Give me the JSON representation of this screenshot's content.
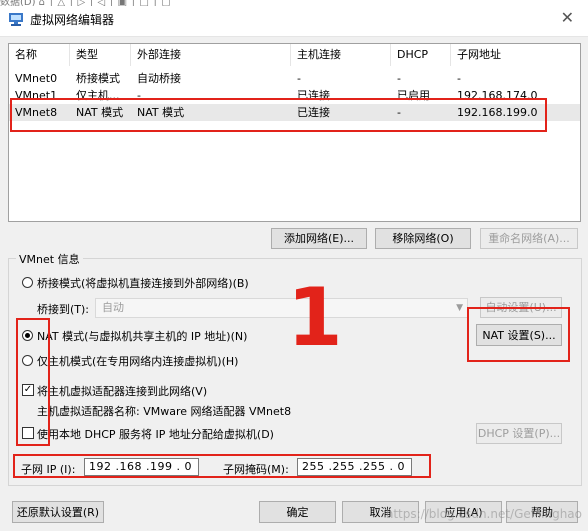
{
  "window": {
    "title": "虚拟网络编辑器",
    "top_text": "  数据(D)    ⌂   │ △ │ ▷ │ ◁ │ ▣ │ □ │ ▢"
  },
  "list": {
    "columns": [
      "名称",
      "类型",
      "外部连接",
      "主机连接",
      "DHCP",
      "子网地址"
    ],
    "rows": [
      [
        "VMnet0",
        "桥接模式",
        "自动桥接",
        "-",
        "-",
        "-"
      ],
      [
        "VMnet1",
        "仅主机...",
        "-",
        "已连接",
        "已启用",
        "192.168.174.0"
      ],
      [
        "VMnet8",
        "NAT 模式",
        "NAT 模式",
        "已连接",
        "-",
        "192.168.199.0"
      ]
    ]
  },
  "buttons": {
    "add_network": "添加网络(E)...",
    "remove_network": "移除网络(O)",
    "rename_network": "重命名网络(A)...",
    "auto_settings": "自动设置(U)...",
    "nat_settings": "NAT 设置(S)...",
    "dhcp_settings": "DHCP 设置(P)...",
    "restore_defaults": "还原默认设置(R)",
    "ok": "确定",
    "cancel": "取消",
    "apply": "应用(A)",
    "help": "帮助"
  },
  "vmnet_info": {
    "group_label": "VMnet 信息",
    "bridged_label": "桥接模式(将虚拟机直接连接到外部网络)(B)",
    "bridged_to_label": "桥接到(T):",
    "bridged_to_value": "自动",
    "nat_label": "NAT 模式(与虚拟机共享主机的 IP 地址)(N)",
    "hostonly_label": "仅主机模式(在专用网络内连接虚拟机)(H)",
    "connect_adapter_label": "将主机虚拟适配器连接到此网络(V)",
    "adapter_name_label": "主机虚拟适配器名称: VMware 网络适配器 VMnet8",
    "use_dhcp_label": "使用本地 DHCP 服务将 IP 地址分配给虚拟机(D)",
    "subnet_ip_label": "子网 IP (I):",
    "subnet_ip_value": "192 .168 .199 .  0",
    "subnet_mask_label": "子网掩码(M):",
    "subnet_mask_value": "255 .255 .255 .  0",
    "selected_mode": "nat",
    "connect_adapter_checked": true,
    "use_dhcp_checked": false
  },
  "annotation": {
    "number": "1",
    "color": "#e2231a"
  },
  "watermark": "https://blog.csdn.net/GeMinghao"
}
